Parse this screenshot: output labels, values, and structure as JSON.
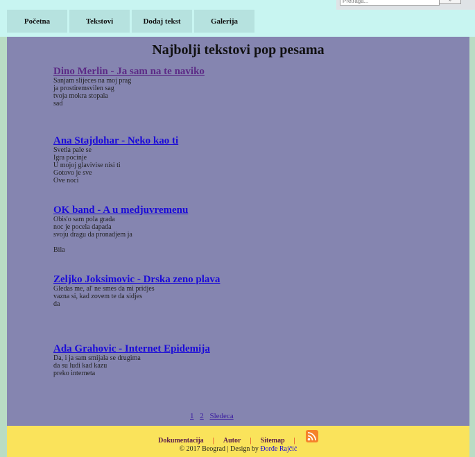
{
  "nav": {
    "items": [
      {
        "label": "Početna"
      },
      {
        "label": "Tekstovi"
      },
      {
        "label": "Dodaj tekst"
      },
      {
        "label": "Galerija"
      }
    ]
  },
  "search": {
    "placeholder": "Pretraga...",
    "button_label": "»"
  },
  "main": {
    "title": "Najbolji tekstovi pop pesama",
    "entries": [
      {
        "title": "Dino Merlin - Ja sam na te naviko",
        "visited": true,
        "lines": [
          "Sanjam slijeces na moj prag",
          "ja prostiremsvilen sag",
          "tvoja mokra stopala",
          "sad"
        ]
      },
      {
        "title": "Ana Stajdohar - Neko kao ti",
        "visited": false,
        "lines": [
          "Svetla pale se",
          "Igra pocinje",
          "U mojoj glavivise nisi ti",
          "Gotovo je sve",
          "Ove noci"
        ]
      },
      {
        "title": "OK band - A u medjuvremenu",
        "visited": false,
        "lines": [
          "Obis'o sam pola grada",
          "noc je pocela dapada",
          "svoju dragu da pronadjem ja",
          "",
          "Bila"
        ]
      },
      {
        "title": "Zeljko Joksimovic - Drska zeno plava",
        "visited": false,
        "lines": [
          "Gledas me, al' ne smes da mi pridjes",
          "vazna si, kad zovem te da sidjes",
          "da"
        ]
      },
      {
        "title": "Ada Grahovic - Internet Epidemija",
        "visited": false,
        "lines": [
          "Da, i ja sam smijala se drugima",
          "da su ludi kad kazu",
          "preko interneta"
        ]
      }
    ],
    "pagination": {
      "pages": [
        "1",
        "2"
      ],
      "next_label": "Sledeca"
    }
  },
  "footer": {
    "links": [
      "Dokumentacija",
      "Autor",
      "Sitemap"
    ],
    "separator": "|",
    "copyright_prefix": "© 2017 Beograd | Design by ",
    "author": "Đorđe Rajčić"
  },
  "colors": {
    "topbar": "#c8f5f1",
    "main": "#8585b0",
    "footer": "#fae35b",
    "link": "#1a0ad8",
    "visited_link": "#5c2a86"
  }
}
